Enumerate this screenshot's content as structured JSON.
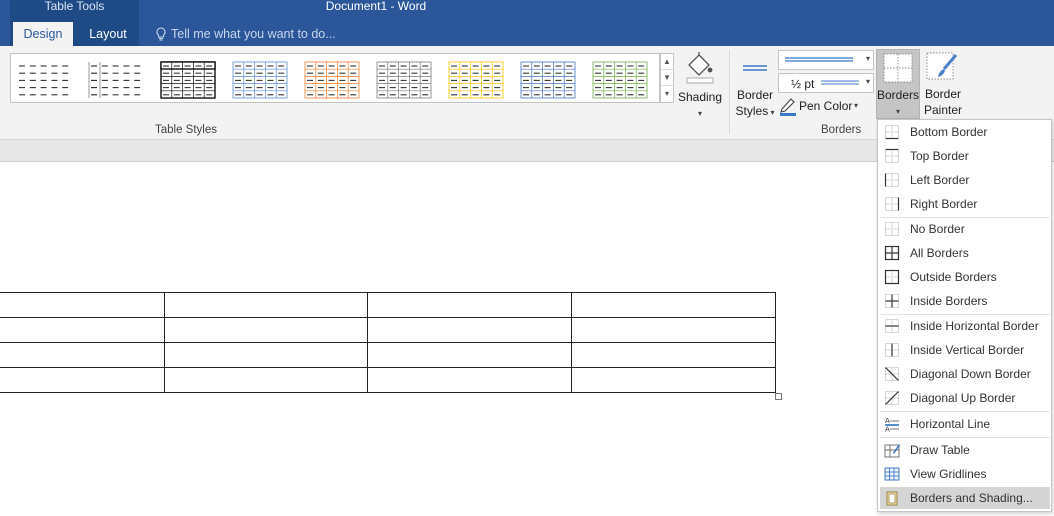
{
  "window": {
    "contextual_group": "Table Tools",
    "title": "Document1 - Word"
  },
  "tabs": [
    {
      "label": "Design",
      "active": true
    },
    {
      "label": "Layout",
      "active": false
    }
  ],
  "tell_me": {
    "placeholder": "Tell me what you want to do..."
  },
  "ribbon": {
    "table_styles": {
      "group_label": "Table Styles",
      "styles": [
        {
          "name": "Plain Table",
          "color": "#222222"
        },
        {
          "name": "Plain Table Lines",
          "color": "#222222"
        },
        {
          "name": "Table Grid Bold",
          "color": "#111111"
        },
        {
          "name": "Grid Table Accent 1",
          "color": "#5b8bd6"
        },
        {
          "name": "Grid Table Accent 2",
          "color": "#ed7d31"
        },
        {
          "name": "Grid Table Accent 3",
          "color": "#7a7a7a"
        },
        {
          "name": "Grid Table Accent 4",
          "color": "#ffc000"
        },
        {
          "name": "Grid Table Accent 5",
          "color": "#4472c4"
        },
        {
          "name": "Grid Table Accent 6",
          "color": "#70ad47"
        }
      ]
    },
    "shading": {
      "label": "Shading"
    },
    "borders_group": {
      "group_label": "Borders",
      "border_styles_line1": "Border",
      "border_styles_line2": "Styles",
      "weight": "½ pt",
      "pen_color": "Pen Color",
      "borders_label": "Borders",
      "painter_line1": "Border",
      "painter_line2": "Painter"
    }
  },
  "document": {
    "table": {
      "rows": 4,
      "cols": 4
    }
  },
  "borders_menu": {
    "items": [
      {
        "label": "Bottom Border",
        "icon": "bottom-border-icon"
      },
      {
        "label": "Top Border",
        "icon": "top-border-icon"
      },
      {
        "label": "Left Border",
        "icon": "left-border-icon"
      },
      {
        "label": "Right Border",
        "icon": "right-border-icon"
      },
      {
        "label": "No Border",
        "icon": "no-border-icon"
      },
      {
        "label": "All Borders",
        "icon": "all-borders-icon"
      },
      {
        "label": "Outside Borders",
        "icon": "outside-borders-icon"
      },
      {
        "label": "Inside Borders",
        "icon": "inside-borders-icon"
      },
      {
        "label": "Inside Horizontal Border",
        "icon": "inside-horizontal-border-icon"
      },
      {
        "label": "Inside Vertical Border",
        "icon": "inside-vertical-border-icon"
      },
      {
        "label": "Diagonal Down Border",
        "icon": "diagonal-down-border-icon"
      },
      {
        "label": "Diagonal Up Border",
        "icon": "diagonal-up-border-icon"
      },
      {
        "label": "Horizontal Line",
        "icon": "horizontal-line-icon"
      },
      {
        "label": "Draw Table",
        "icon": "draw-table-icon"
      },
      {
        "label": "View Gridlines",
        "icon": "view-gridlines-icon"
      },
      {
        "label": "Borders and Shading...",
        "icon": "borders-and-shading-icon",
        "highlighted": true
      }
    ]
  }
}
